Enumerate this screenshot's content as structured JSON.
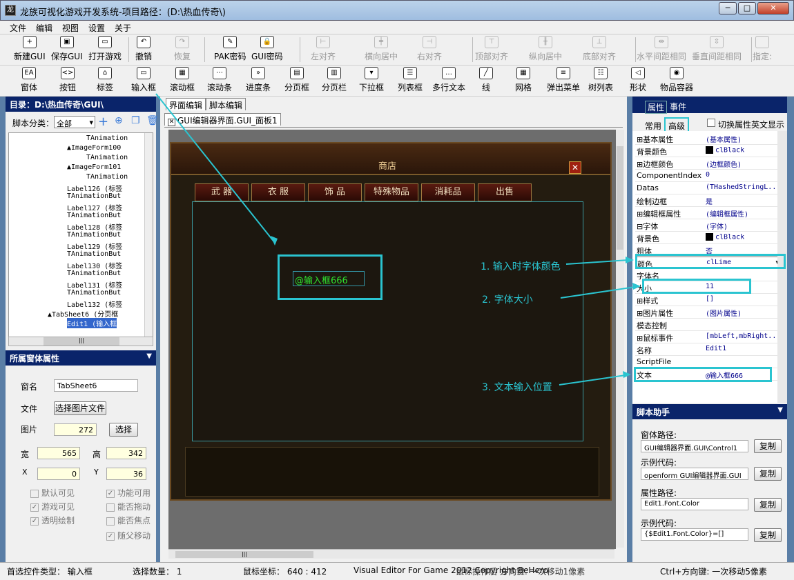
{
  "window": {
    "title": "龙族可视化游戏开发系统-项目路径：(D:\\热血传奇\\)",
    "min": "─",
    "max": "□",
    "close": "✕"
  },
  "menu": [
    "文件",
    "编辑",
    "视图",
    "设置",
    "关于"
  ],
  "toolbar1": [
    {
      "label": "新建GUI",
      "icon": "new-gui-icon",
      "glyph": "+",
      "enabled": true
    },
    {
      "label": "保存GUI",
      "icon": "save-gui-icon",
      "glyph": "▣",
      "enabled": true
    },
    {
      "label": "打开游戏",
      "icon": "open-game-icon",
      "glyph": "▭",
      "enabled": true
    },
    {
      "label": "撤销",
      "icon": "undo-icon",
      "glyph": "↶",
      "enabled": true
    },
    {
      "label": "恢复",
      "icon": "redo-icon",
      "glyph": "↷",
      "enabled": false
    },
    {
      "label": "PAK密码",
      "icon": "pak-password-icon",
      "glyph": "✎",
      "enabled": true
    },
    {
      "label": "GUI密码",
      "icon": "gui-password-icon",
      "glyph": "🔒",
      "enabled": true
    },
    {
      "label": "左对齐",
      "icon": "align-left-icon",
      "glyph": "⊢",
      "enabled": false
    },
    {
      "label": "横向居中",
      "icon": "center-horizontal-icon",
      "glyph": "╪",
      "enabled": false
    },
    {
      "label": "右对齐",
      "icon": "align-right-icon",
      "glyph": "⊣",
      "enabled": false
    },
    {
      "label": "顶部对齐",
      "icon": "align-top-icon",
      "glyph": "⊤",
      "enabled": false
    },
    {
      "label": "纵向居中",
      "icon": "center-vertical-icon",
      "glyph": "╫",
      "enabled": false
    },
    {
      "label": "底部对齐",
      "icon": "align-bottom-icon",
      "glyph": "⊥",
      "enabled": false
    },
    {
      "label": "水平间距相同",
      "icon": "equal-h-spacing-icon",
      "glyph": "⇹",
      "enabled": false
    },
    {
      "label": "垂直间距相同",
      "icon": "equal-v-spacing-icon",
      "glyph": "⇳",
      "enabled": false
    },
    {
      "label": "指定:",
      "icon": "specify-icon",
      "glyph": "",
      "enabled": false
    }
  ],
  "toolbar2": [
    {
      "label": "窗体",
      "icon": "form-icon",
      "glyph": "EA"
    },
    {
      "label": "按钮",
      "icon": "button-icon",
      "glyph": "<>"
    },
    {
      "label": "标签",
      "icon": "label-icon",
      "glyph": "⌂"
    },
    {
      "label": "输入框",
      "icon": "input-box-icon",
      "glyph": "▭"
    },
    {
      "label": "滚动框",
      "icon": "scroll-box-icon",
      "glyph": "▦"
    },
    {
      "label": "滚动条",
      "icon": "scrollbar-icon",
      "glyph": "⋯"
    },
    {
      "label": "进度条",
      "icon": "progress-bar-icon",
      "glyph": "»"
    },
    {
      "label": "分页框",
      "icon": "page-control-icon",
      "glyph": "▤"
    },
    {
      "label": "分页栏",
      "icon": "tab-bar-icon",
      "glyph": "▥"
    },
    {
      "label": "下拉框",
      "icon": "combobox-icon",
      "glyph": "▾"
    },
    {
      "label": "列表框",
      "icon": "listbox-icon",
      "glyph": "☰"
    },
    {
      "label": "多行文本",
      "icon": "memo-icon",
      "glyph": "…"
    },
    {
      "label": "线",
      "icon": "line-icon",
      "glyph": "╱"
    },
    {
      "label": "网格",
      "icon": "grid-icon",
      "glyph": "▦"
    },
    {
      "label": "弹出菜单",
      "icon": "popup-menu-icon",
      "glyph": "≡"
    },
    {
      "label": "树列表",
      "icon": "tree-list-icon",
      "glyph": "☷"
    },
    {
      "label": "形状",
      "icon": "shape-icon",
      "glyph": "◁"
    },
    {
      "label": "物品容器",
      "icon": "item-container-icon",
      "glyph": "◉"
    }
  ],
  "left": {
    "dir_header": "目录：D:\\热血传奇\\GUI\\",
    "script_category_label": "脚本分类：",
    "script_category_value": "全部",
    "tree": [
      {
        "text": "TAnimation",
        "indent": 8
      },
      {
        "text": "▲ImageForm100",
        "indent": 6
      },
      {
        "text": "TAnimation",
        "indent": 8
      },
      {
        "text": "▲ImageForm101",
        "indent": 6
      },
      {
        "text": "TAnimation",
        "indent": 8
      },
      {
        "text": "Label126 (标签",
        "indent": 6
      },
      {
        "text": "TAnimationBut",
        "indent": 6
      },
      {
        "text": "Label127 (标签",
        "indent": 6
      },
      {
        "text": "TAnimationBut",
        "indent": 6
      },
      {
        "text": "Label128 (标签",
        "indent": 6
      },
      {
        "text": "TAnimationBut",
        "indent": 6
      },
      {
        "text": "Label129 (标签",
        "indent": 6
      },
      {
        "text": "TAnimationBut",
        "indent": 6
      },
      {
        "text": "Label130 (标签",
        "indent": 6
      },
      {
        "text": "TAnimationBut",
        "indent": 6
      },
      {
        "text": "Label131 (标签",
        "indent": 6
      },
      {
        "text": "TAnimationBut",
        "indent": 6
      },
      {
        "text": "Label132 (标签",
        "indent": 6
      },
      {
        "text": "▲TabSheet6 (分页框",
        "indent": 4
      },
      {
        "text": "Edit1 (输入框",
        "indent": 6,
        "selected": true
      }
    ],
    "props_header": "所属窗体属性",
    "form_name_label": "窗名",
    "form_name": "TabSheet6",
    "file_label": "文件",
    "select_image_file": "选择图片文件",
    "image_label": "图片",
    "image_value": "272",
    "select_btn": "选择",
    "width_label": "宽",
    "width": "565",
    "height_label": "高",
    "height": "342",
    "x_label": "X",
    "x": "0",
    "y_label": "Y",
    "y": "36",
    "checks": [
      {
        "label": "默认可见",
        "checked": false
      },
      {
        "label": "功能可用",
        "checked": true
      },
      {
        "label": "游戏可见",
        "checked": true
      },
      {
        "label": "能否拖动",
        "checked": false
      },
      {
        "label": "透明绘制",
        "checked": true
      },
      {
        "label": "能否焦点",
        "checked": false
      },
      {
        "label": "随父移动",
        "checked": true
      }
    ]
  },
  "center": {
    "tabs": [
      "界面编辑",
      "脚本编辑"
    ],
    "doc_tab": "GUI编辑器界面.GUI_面板1",
    "shop_title": "商店",
    "shop_tabs": [
      "武 器",
      "衣 服",
      "饰 品",
      "特殊物品",
      "消耗品",
      "出售"
    ],
    "edit_text": "@输入框666"
  },
  "annotations": [
    "1. 输入时字体颜色",
    "2. 字体大小",
    "3. 文本输入位置"
  ],
  "right": {
    "tabs": [
      "属性",
      "事件"
    ],
    "subtabs": [
      "常用",
      "高级"
    ],
    "toggle_en": "切换属性英文显示",
    "props": [
      {
        "k": "⊞基本属性",
        "v": "(基本属性)"
      },
      {
        "k": "  背景颜色",
        "v": "clBlack",
        "swatch": true
      },
      {
        "k": "⊞边框颜色",
        "v": "(边框颜色)"
      },
      {
        "k": "  ComponentIndex",
        "v": "0"
      },
      {
        "k": "  Datas",
        "v": "(THashedStringL..."
      },
      {
        "k": "  绘制边框",
        "v": "是"
      },
      {
        "k": "⊞编辑框属性",
        "v": "(编辑框属性)"
      },
      {
        "k": "⊟字体",
        "v": "(字体)"
      },
      {
        "k": "    背景色",
        "v": "clBlack",
        "swatch": true
      },
      {
        "k": "    粗体",
        "v": "否"
      },
      {
        "k": "    颜色",
        "v": "clLime",
        "selected": true
      },
      {
        "k": "    字体名",
        "v": ""
      },
      {
        "k": "    大小",
        "v": "11"
      },
      {
        "k": "  ⊞样式",
        "v": "[]"
      },
      {
        "k": "⊞图片属性",
        "v": "(图片属性)"
      },
      {
        "k": "  模态控制",
        "v": ""
      },
      {
        "k": "⊞鼠标事件",
        "v": "[mbLeft,mbRight..."
      },
      {
        "k": "  名称",
        "v": "Edit1"
      },
      {
        "k": "  ScriptFile",
        "v": ""
      },
      {
        "k": "  文本",
        "v": "@输入框666"
      }
    ],
    "script_header": "脚本助手",
    "form_path_label": "窗体路径:",
    "form_path": "GUI编辑器界面.GUI\\Control1",
    "example1_label": "示例代码:",
    "example1": "openform GUI编辑器界面.GUI",
    "prop_path_label": "属性路径:",
    "prop_path": "Edit1.Font.Color",
    "example2_label": "示例代码:",
    "example2": "{$Edit1.Font.Color}=[]",
    "copy": "复制"
  },
  "status": {
    "type": "首选控件类型： 输入框",
    "count": "选择数量： 1",
    "mouse": "鼠标坐标： 640 : 412",
    "info": "Visual Editor For Game 2012 Copyright BeHero",
    "hint1": "鼠标操作后 方向键: 一次移动1像素",
    "hint2": "Ctrl+方向键: 一次移动5像素"
  },
  "colors": {
    "accent_cyan": "#2ac4d0",
    "header_blue": "#0a246a",
    "lime": "#00ff00"
  }
}
